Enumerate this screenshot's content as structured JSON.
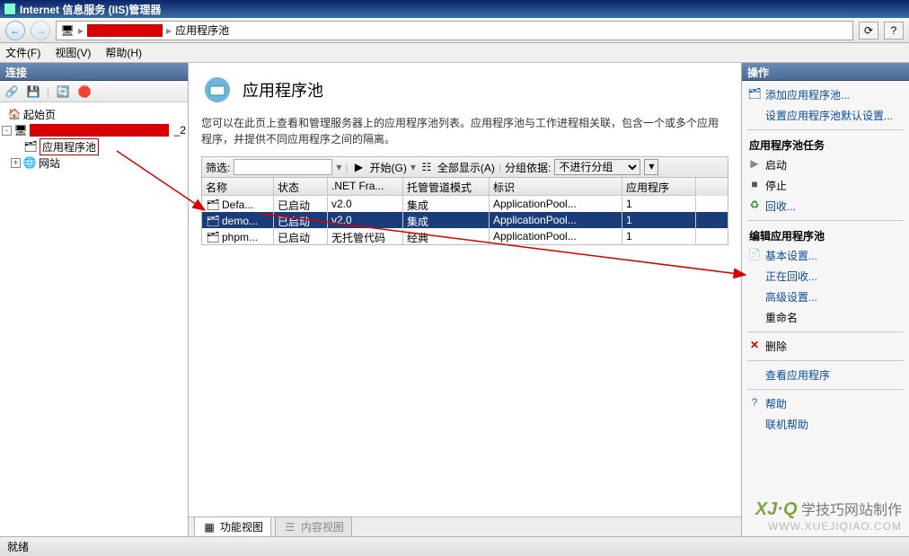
{
  "window": {
    "title": "Internet 信息服务 (IIS)管理器"
  },
  "breadcrumb": {
    "root_icon": "server-icon",
    "current": "应用程序池"
  },
  "menu": {
    "file": "文件(F)",
    "view": "视图(V)",
    "help": "帮助(H)"
  },
  "left": {
    "header": "连接",
    "tree": {
      "start": "起始页",
      "server_suffix": "_2",
      "pool": "应用程序池",
      "sites": "网站"
    }
  },
  "main": {
    "title": "应用程序池",
    "desc": "您可以在此页上查看和管理服务器上的应用程序池列表。应用程序池与工作进程相关联，包含一个或多个应用程序，并提供不同应用程序之间的隔离。",
    "filter_label": "筛选:",
    "go_label": "开始(G)",
    "showall_label": "全部显示(A)",
    "groupby_label": "分组依据:",
    "groupby_value": "不进行分组",
    "columns": {
      "c1": "名称",
      "c2": "状态",
      "c3": ".NET Fra...",
      "c4": "托管管道模式",
      "c5": "标识",
      "c6": "应用程序"
    },
    "rows": [
      {
        "name": "Defa...",
        "status": "已启动",
        "net": "v2.0",
        "mode": "集成",
        "ident": "ApplicationPool...",
        "apps": "1",
        "sel": false
      },
      {
        "name": "demo...",
        "status": "已启动",
        "net": "v2.0",
        "mode": "集成",
        "ident": "ApplicationPool...",
        "apps": "1",
        "sel": true
      },
      {
        "name": "phpm...",
        "status": "已启动",
        "net": "无托管代码",
        "mode": "经典",
        "ident": "ApplicationPool...",
        "apps": "1",
        "sel": false
      }
    ],
    "tab_features": "功能视图",
    "tab_content": "内容视图"
  },
  "actions": {
    "header": "操作",
    "add_pool": "添加应用程序池...",
    "set_defaults": "设置应用程序池默认设置...",
    "tasks_hdr": "应用程序池任务",
    "start": "启动",
    "stop": "停止",
    "recycle": "回收...",
    "edit_hdr": "编辑应用程序池",
    "basic": "基本设置...",
    "recycling": "正在回收...",
    "advanced": "高级设置...",
    "rename": "重命名",
    "delete": "删除",
    "view_apps": "查看应用程序",
    "help": "帮助",
    "online_help": "联机帮助"
  },
  "status": {
    "ready": "就绪"
  },
  "watermark": {
    "brand_prefix": "XJ",
    "brand_suffix": "Q",
    "brand_text": "学技巧网站制作",
    "url": "WWW.XUEJIQIAO.COM"
  }
}
